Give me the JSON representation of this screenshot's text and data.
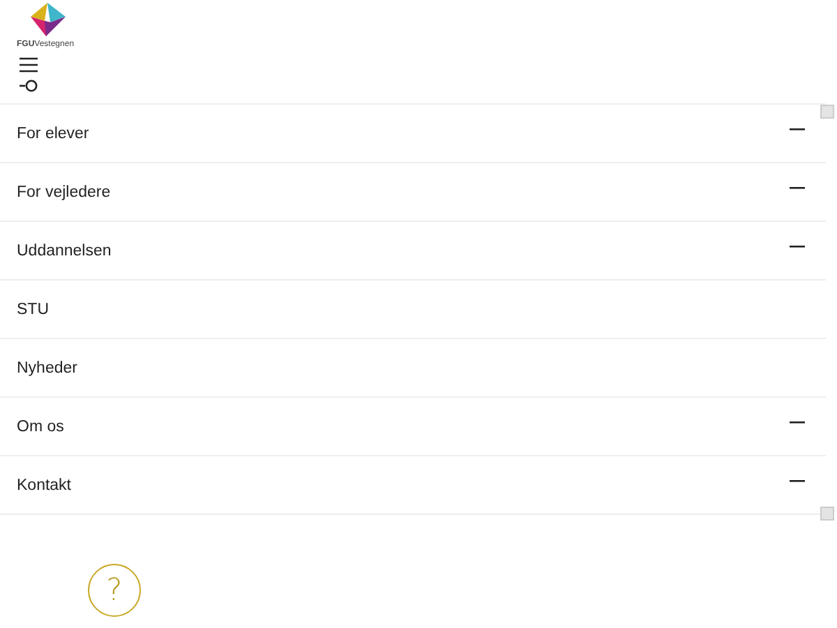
{
  "logo": {
    "text": "**FGU**Vestegnen"
  },
  "menu": [
    {
      "label": "For elever",
      "expandable": true
    },
    {
      "label": "For vejledere",
      "expandable": true
    },
    {
      "label": "Uddannelsen",
      "expandable": true
    },
    {
      "label": "STU",
      "expandable": false
    },
    {
      "label": "Nyheder",
      "expandable": false
    },
    {
      "label": "Om os",
      "expandable": true
    },
    {
      "label": "Kontakt",
      "expandable": true
    }
  ],
  "help": {
    "label": "?"
  }
}
